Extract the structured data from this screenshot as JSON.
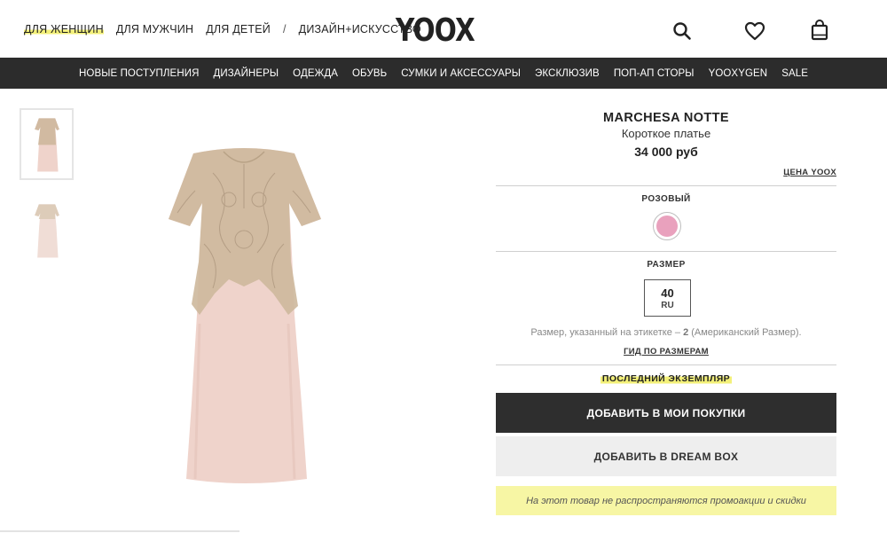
{
  "header": {
    "gender_nav": [
      {
        "label": "ДЛЯ ЖЕНЩИН",
        "active": true
      },
      {
        "label": "ДЛЯ МУЖЧИН",
        "active": false
      },
      {
        "label": "ДЛЯ ДЕТЕЙ",
        "active": false
      }
    ],
    "separator": "/",
    "design_art": "ДИЗАЙН+ИСКУССТВО",
    "logo": "YOOX",
    "icons": [
      "search-icon",
      "heart-icon",
      "shopping-bag-icon"
    ]
  },
  "category_nav": [
    "НОВЫЕ ПОСТУПЛЕНИЯ",
    "ДИЗАЙНЕРЫ",
    "ОДЕЖДА",
    "ОБУВЬ",
    "СУМКИ И АКСЕССУАРЫ",
    "ЭКСКЛЮЗИВ",
    "ПОП-АП СТОРЫ",
    "YOOXYGEN",
    "SALE"
  ],
  "gallery": {
    "thumbnails": [
      "front-view",
      "back-view"
    ],
    "selected_index": 0
  },
  "product": {
    "brand": "MARCHESA NOTTE",
    "type": "Короткое платье",
    "price": "34 000 руб",
    "price_link": "ЦЕНА YOOX",
    "color_label": "РОЗОВЫЙ",
    "color_hex": "#e9a1bd",
    "size_label": "РАЗМЕР",
    "size_value": "40",
    "size_unit": "RU",
    "size_note_prefix": "Размер, указанный на этикетке – ",
    "size_note_bold": "2",
    "size_note_suffix": " (Американский Размер).",
    "size_guide": "ГИД ПО РАЗМЕРАМ",
    "last_item": "ПОСЛЕДНИЙ ЭКЗЕМПЛЯР",
    "add_to_cart": "ДОБАВИТЬ В МОИ ПОКУПКИ",
    "add_to_dreambox": "ДОБАВИТЬ В DREAM BOX",
    "promo_note": "На этот товар не распространяются промоакции и скидки"
  },
  "colors": {
    "dark_bar": "#2c2c2c",
    "highlight": "#f3f079",
    "promo_bg": "#f7f6a4",
    "dress_pink": "#efd3cb",
    "lace_gold": "#c8b79d"
  }
}
